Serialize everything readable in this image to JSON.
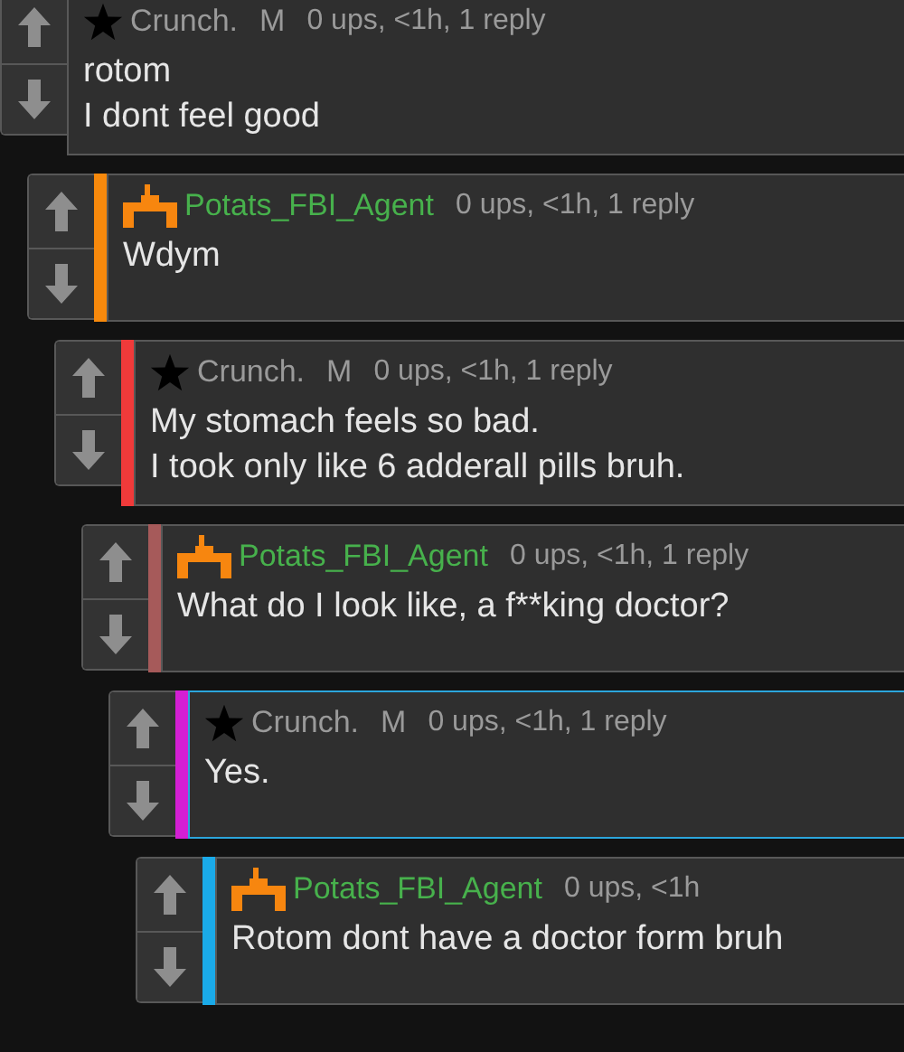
{
  "comments": [
    {
      "author": "Crunch.",
      "kind": "star",
      "badge": "M",
      "meta": "0 ups, <1h, 1 reply",
      "lines": [
        "rotom",
        "I dont feel good"
      ],
      "highlighted": false,
      "children": [
        {
          "author": "Potats_FBI_Agent",
          "kind": "arch",
          "meta": "0 ups, <1h, 1 reply",
          "color": "#f7890c",
          "lines": [
            "Wdym"
          ],
          "highlighted": false,
          "children": [
            {
              "author": "Crunch.",
              "kind": "star",
              "badge": "M",
              "meta": "0 ups, <1h, 1 reply",
              "color": "#f03a3a",
              "lines": [
                "My stomach feels so bad.",
                "I took only like 6 adderall pills bruh."
              ],
              "highlighted": false,
              "children": [
                {
                  "author": "Potats_FBI_Agent",
                  "kind": "arch",
                  "meta": "0 ups, <1h, 1 reply",
                  "color": "#a65a5a",
                  "lines": [
                    "What do I look like, a f**king doctor?"
                  ],
                  "highlighted": false,
                  "children": [
                    {
                      "author": "Crunch.",
                      "kind": "star",
                      "badge": "M",
                      "meta": "0 ups, <1h, 1 reply",
                      "color": "#d41fd4",
                      "lines": [
                        "Yes."
                      ],
                      "highlighted": true,
                      "children": [
                        {
                          "author": "Potats_FBI_Agent",
                          "kind": "arch",
                          "meta": "0 ups, <1h",
                          "color": "#1aaae8",
                          "lines": [
                            "Rotom dont have a doctor form bruh"
                          ],
                          "highlighted": false
                        }
                      ]
                    }
                  ]
                }
              ]
            }
          ]
        }
      ]
    }
  ]
}
